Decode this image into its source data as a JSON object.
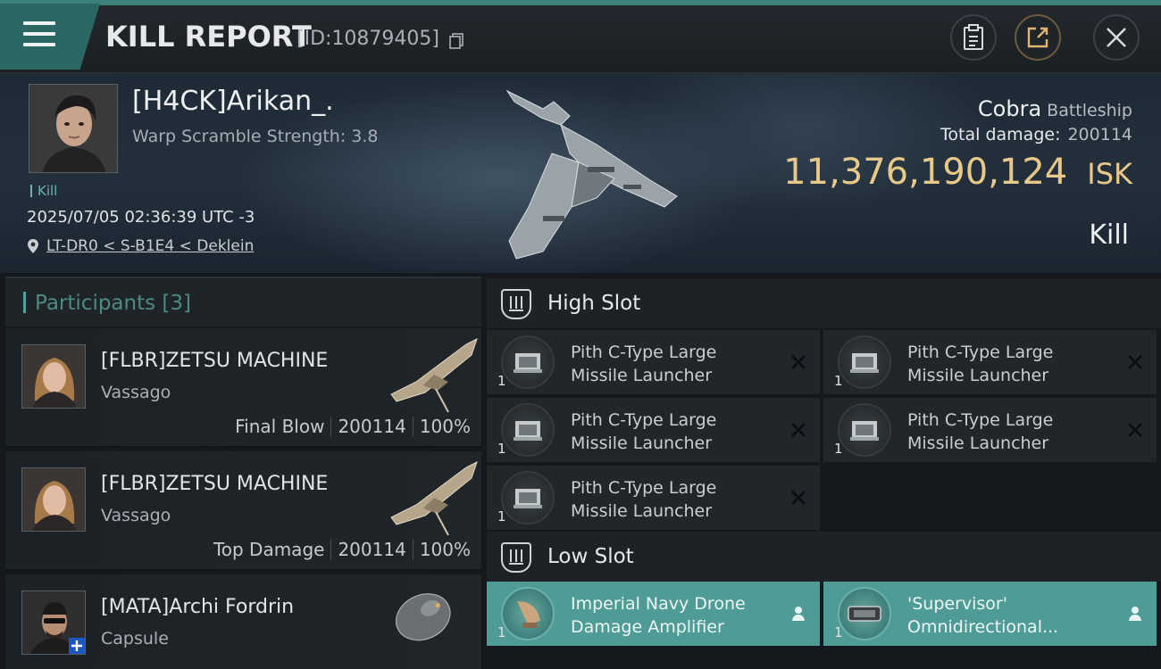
{
  "header": {
    "title": "KILL REPORT",
    "report_id": "[ID:10879405]",
    "accent": "#2b6763"
  },
  "victim": {
    "name": "[H4CK]Arikan_.",
    "warp_scramble": "Warp Scramble Strength: 3.8",
    "kill_tag": "Kill",
    "timestamp": "2025/07/05 02:36:39 UTC -3",
    "location": "LT-DR0 < S-B1E4 < Deklein",
    "ship": "Cobra",
    "ship_class": "Battleship",
    "total_damage_label": "Total damage:",
    "total_damage": "200114",
    "isk_value": "11,376,190,124",
    "isk_unit": "ISK",
    "result": "Kill"
  },
  "participants": {
    "title": "Participants",
    "count": "[3]",
    "items": [
      {
        "name": "[FLBR]ZETSU MACHINE",
        "ship": "Vassago",
        "role": "Final Blow",
        "damage": "200114",
        "percent": "100%"
      },
      {
        "name": "[FLBR]ZETSU MACHINE",
        "ship": "Vassago",
        "role": "Top Damage",
        "damage": "200114",
        "percent": "100%"
      },
      {
        "name": "[MATA]Archi Fordrin",
        "ship": "Capsule"
      }
    ]
  },
  "fitting": {
    "high_slot": {
      "title": "High Slot",
      "modules": [
        {
          "line1": "Pith C-Type Large",
          "line2": "Missile Launcher",
          "qty": "1",
          "status": "destroyed"
        },
        {
          "line1": "Pith C-Type Large",
          "line2": "Missile Launcher",
          "qty": "1",
          "status": "destroyed"
        },
        {
          "line1": "Pith C-Type Large",
          "line2": "Missile Launcher",
          "qty": "1",
          "status": "destroyed"
        },
        {
          "line1": "Pith C-Type Large",
          "line2": "Missile Launcher",
          "qty": "1",
          "status": "destroyed"
        },
        {
          "line1": "Pith C-Type Large",
          "line2": "Missile Launcher",
          "qty": "1",
          "status": "destroyed"
        }
      ]
    },
    "low_slot": {
      "title": "Low Slot",
      "modules": [
        {
          "line1": "Imperial Navy Drone",
          "line2": "Damage Amplifier",
          "qty": "1",
          "status": "dropped"
        },
        {
          "line1": "'Supervisor'",
          "line2": "Omnidirectional...",
          "qty": "1",
          "status": "dropped"
        }
      ]
    }
  }
}
